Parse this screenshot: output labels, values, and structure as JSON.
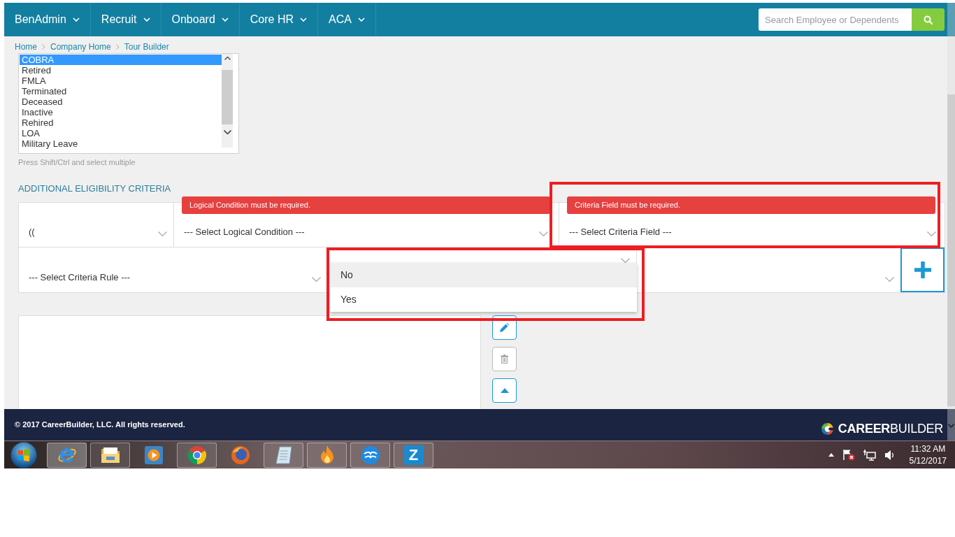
{
  "nav": {
    "items": [
      {
        "label": "BenAdmin"
      },
      {
        "label": "Recruit"
      },
      {
        "label": "Onboard"
      },
      {
        "label": "Core HR"
      },
      {
        "label": "ACA"
      }
    ],
    "search": {
      "placeholder": "Search Employee or Dependents"
    }
  },
  "breadcrumb": [
    {
      "label": "Home"
    },
    {
      "label": "Company Home"
    },
    {
      "label": "Tour Builder"
    }
  ],
  "status_list": {
    "items": [
      {
        "label": "COBRA",
        "selected": true
      },
      {
        "label": "Retired",
        "selected": false
      },
      {
        "label": "FMLA",
        "selected": false
      },
      {
        "label": "Terminated",
        "selected": false
      },
      {
        "label": "Deceased",
        "selected": false
      },
      {
        "label": "Inactive",
        "selected": false
      },
      {
        "label": "Rehired",
        "selected": false
      },
      {
        "label": "LOA",
        "selected": false
      },
      {
        "label": "Military Leave",
        "selected": false
      }
    ],
    "hint": "Press Shift/Ctrl and select multiple"
  },
  "criteria": {
    "title": "ADDITIONAL ELIGIBILITY CRITERIA",
    "rows": [
      {
        "selects": [
          {
            "value": "((",
            "expanded": false
          },
          {
            "value": "--- Select Logical Condition ---",
            "error": "Logical Condition must be required.",
            "expanded": false
          },
          {
            "value": "--- Select Criteria Field ---",
            "error": "Criteria Field must be required.",
            "expanded": false
          }
        ]
      },
      {
        "selects": [
          {
            "value": "--- Select Criteria Rule ---",
            "expanded": false
          },
          {
            "expanded": true,
            "options": [
              {
                "label": "No",
                "selected": true
              },
              {
                "label": "Yes",
                "selected": false
              }
            ]
          },
          {
            "expanded": false
          }
        ]
      }
    ]
  },
  "actions": [
    {
      "kind": "edit",
      "disabled": false
    },
    {
      "kind": "delete",
      "disabled": true
    },
    {
      "kind": "move_up",
      "disabled": false
    }
  ],
  "footer": {
    "copyright": "© 2017 CareerBuilder, LLC. All rights reserved.",
    "logo": "**CAREER**BUILDER"
  },
  "taskbar": {
    "apps": [
      {
        "kind": "e_browser",
        "running": true,
        "selected": true
      },
      {
        "kind": "folder",
        "running": true,
        "selected": false
      },
      {
        "kind": "player",
        "running": false,
        "selected": false
      },
      {
        "kind": "browser",
        "running": true,
        "selected": false
      },
      {
        "kind": "globe",
        "running": false,
        "selected": false
      },
      {
        "kind": "notepad",
        "running": true,
        "selected": false
      },
      {
        "kind": "flame",
        "running": true,
        "selected": false
      },
      {
        "kind": "waves",
        "running": true,
        "selected": false
      },
      {
        "kind": "tile",
        "glyph": "Z",
        "running": true,
        "selected": false
      }
    ],
    "clock": {
      "time": "11:32 AM",
      "date": "5/12/2017"
    }
  }
}
